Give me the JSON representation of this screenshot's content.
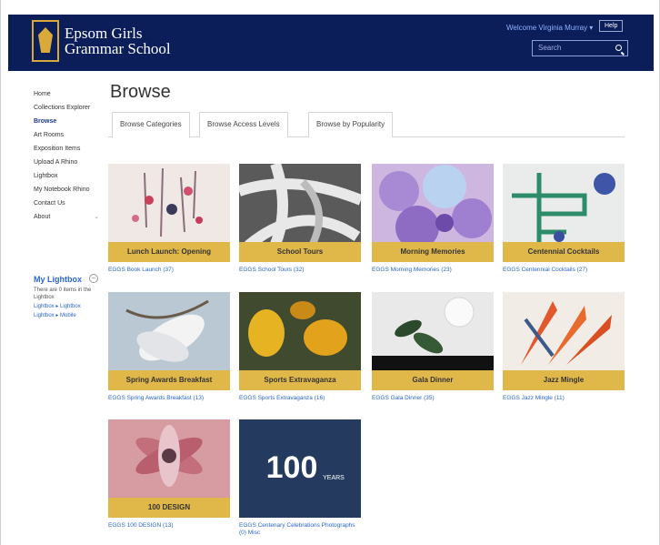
{
  "header": {
    "school_name_line1": "Epsom Girls",
    "school_name_line2": "Grammar School",
    "user_menu": "Welcome Virginia Murray ▾",
    "help_label": "Help",
    "search_placeholder": "Search"
  },
  "sidebar": {
    "items": [
      {
        "label": "Home"
      },
      {
        "label": "Collections Explorer"
      },
      {
        "label": "Browse"
      },
      {
        "label": "Art Rooms"
      },
      {
        "label": "Exposition Items"
      },
      {
        "label": "Upload A Rhino"
      },
      {
        "label": "Lightbox"
      },
      {
        "label": "My Notebook Rhino"
      },
      {
        "label": "Contact Us"
      },
      {
        "label": "About"
      }
    ],
    "lightbox": {
      "title": "My Lightbox",
      "toggle": "–",
      "text": "There are 0 items in the Lightbox",
      "link1": "Lightbox ▸ Lightbox",
      "link2": "Lightbox ▸ Mobile"
    }
  },
  "main": {
    "title": "Browse",
    "tabs": [
      {
        "label": "Browse Categories"
      },
      {
        "label": "Browse Access Levels"
      },
      {
        "label": "Browse by Popularity"
      }
    ],
    "categories": [
      {
        "banner": "Lunch Launch: Opening",
        "caption": "EGGS Book Launch (37)"
      },
      {
        "banner": "School Tours",
        "caption": "EGGS School Tours (32)"
      },
      {
        "banner": "Morning Memories",
        "caption": "EGGS Morning Memories (23)"
      },
      {
        "banner": "Centennial Cocktails",
        "caption": "EGGS Centennial Cocktails (27)"
      },
      {
        "banner": "Spring Awards Breakfast",
        "caption": "EGGS Spring Awards Breakfast (13)"
      },
      {
        "banner": "Sports Extravaganza",
        "caption": "EGGS Sports Extravaganza (16)"
      },
      {
        "banner": "Gala Dinner",
        "caption": "EGGS Gala Dinner (35)"
      },
      {
        "banner": "Jazz Mingle",
        "caption": "EGGS Jazz Mingle (11)"
      },
      {
        "banner": "100 DESIGN",
        "caption": "EGGS 100 DESIGN (13)"
      },
      {
        "banner": "",
        "caption": "EGGS Centenary Celebrations Photographs (0) Misc"
      }
    ],
    "badge_text": "100",
    "badge_years": "YEARS"
  }
}
